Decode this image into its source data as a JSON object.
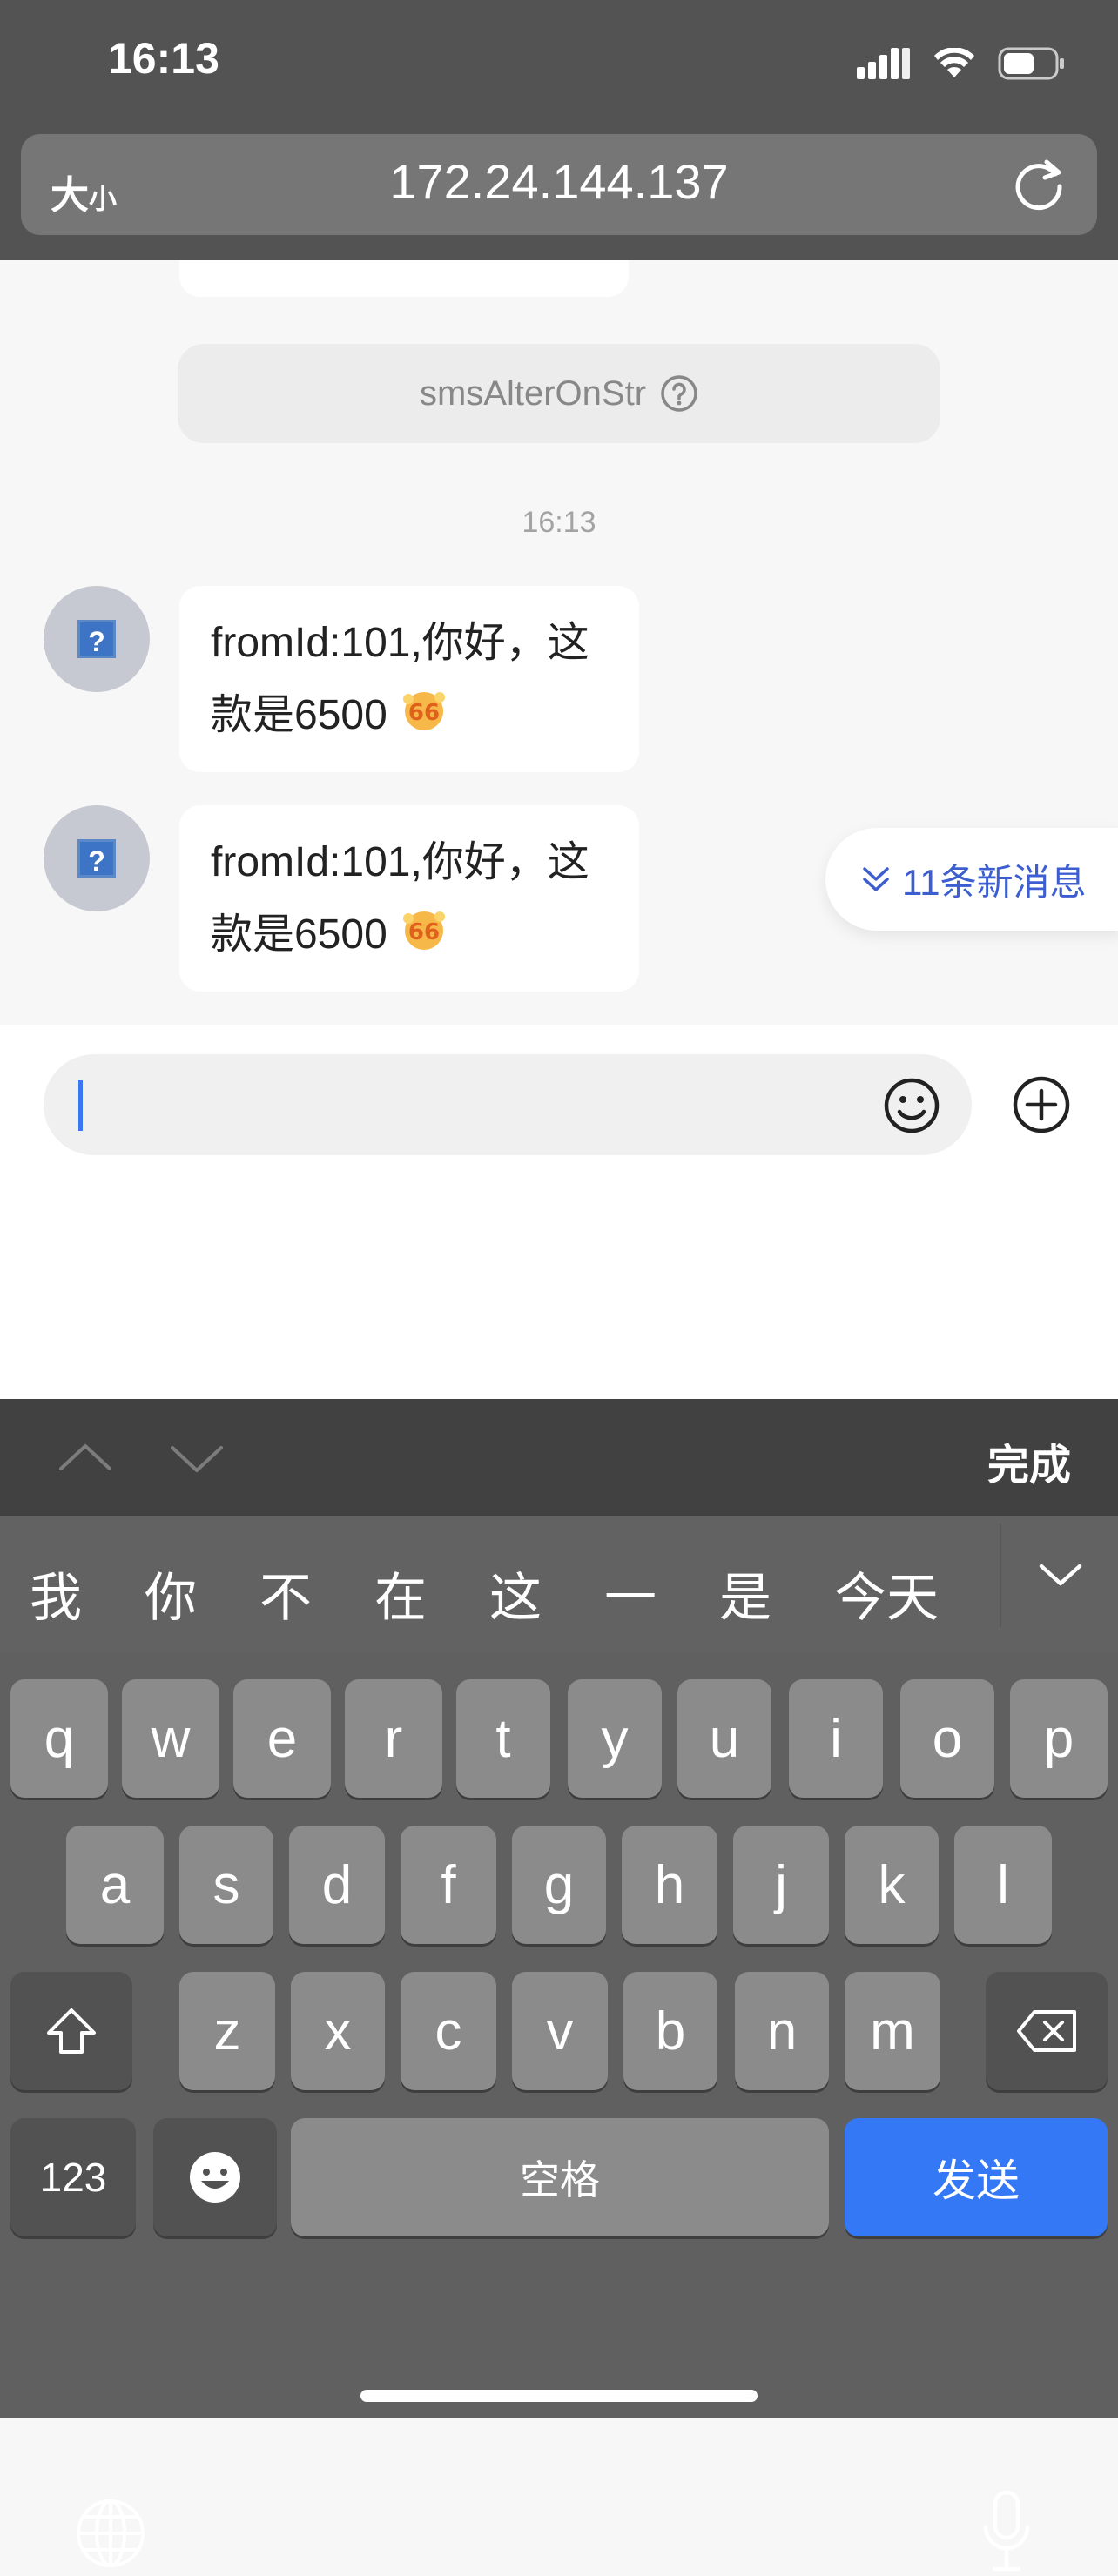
{
  "status_bar": {
    "time": "16:13"
  },
  "browser": {
    "text_size_big": "大",
    "text_size_small": "小",
    "url": "172.24.144.137"
  },
  "chat": {
    "notice": "smsAlterOnStr",
    "timestamp": "16:13",
    "messages": [
      {
        "line1": "fromId:101,你好，这",
        "line2": "款是6500"
      },
      {
        "line1": "fromId:101,你好，这",
        "line2": "款是6500"
      }
    ],
    "new_messages_label": "11条新消息"
  },
  "keyboard": {
    "done": "完成",
    "candidates": [
      "我",
      "你",
      "不",
      "在",
      "这",
      "一",
      "是",
      "今天"
    ],
    "row1": [
      "q",
      "w",
      "e",
      "r",
      "t",
      "y",
      "u",
      "i",
      "o",
      "p"
    ],
    "row2": [
      "a",
      "s",
      "d",
      "f",
      "g",
      "h",
      "j",
      "k",
      "l"
    ],
    "row3": [
      "z",
      "x",
      "c",
      "v",
      "b",
      "n",
      "m"
    ],
    "numbers": "123",
    "space": "空格",
    "send": "发送"
  },
  "colors": {
    "accent": "#3478f6",
    "link_blue": "#3d5ed0"
  }
}
